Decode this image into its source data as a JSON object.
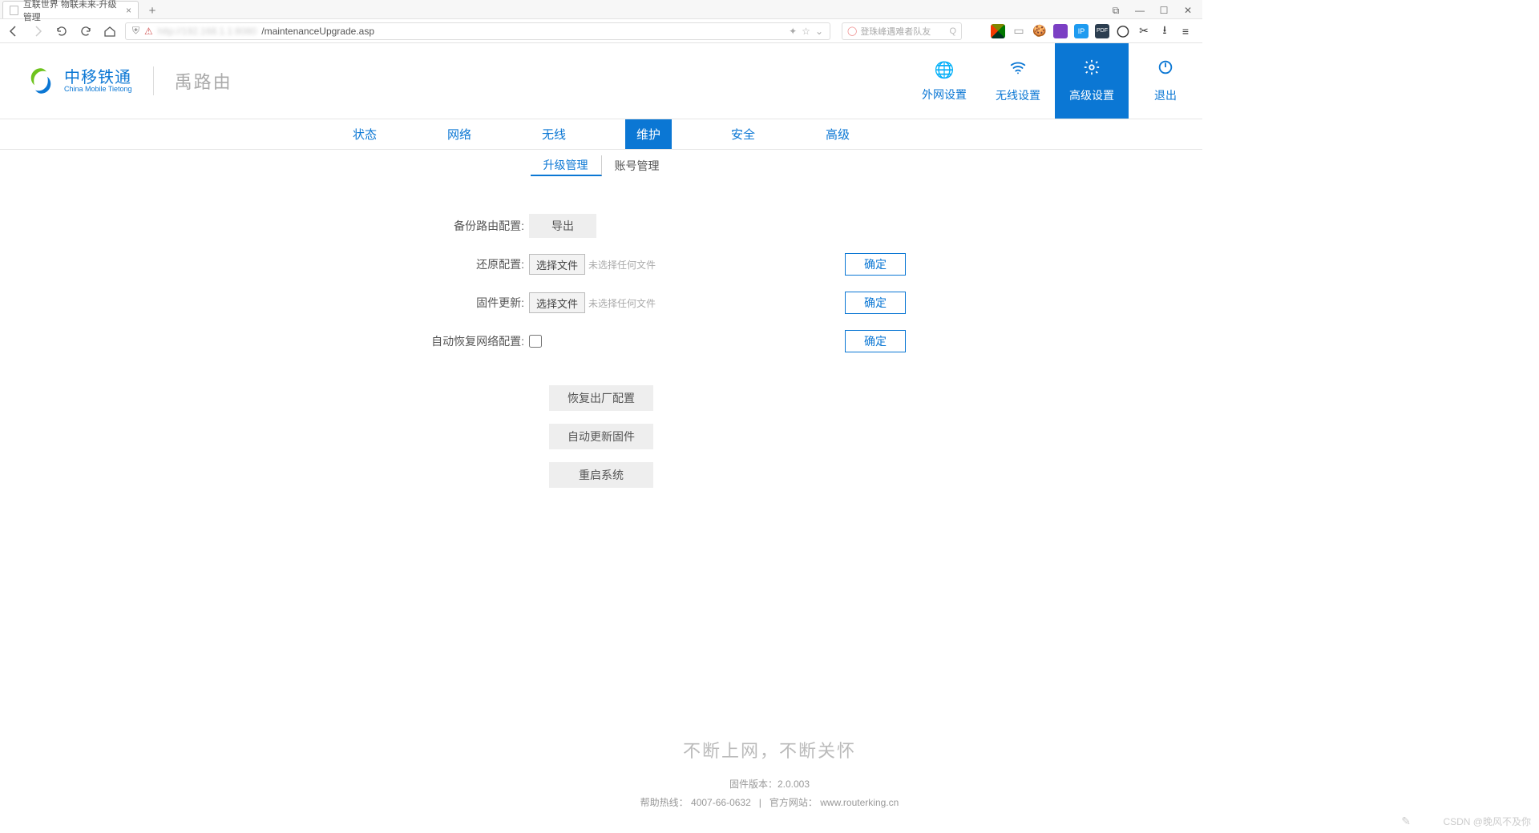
{
  "browser": {
    "tab_title": "互联世界 物联未来-升级管理",
    "url_suffix": "/maintenanceUpgrade.asp",
    "search_placeholder": "登珠峰遇难者队友"
  },
  "header": {
    "brand_cn": "中移铁通",
    "brand_en": "China Mobile Tietong",
    "sub_brand": "禹路由",
    "nav": {
      "wan": "外网设置",
      "wireless": "无线设置",
      "advanced": "高级设置",
      "logout": "退出"
    }
  },
  "subnav": {
    "status": "状态",
    "network": "网络",
    "wireless": "无线",
    "maintenance": "维护",
    "security": "安全",
    "advanced": "高级"
  },
  "subsub": {
    "upgrade": "升级管理",
    "account": "账号管理"
  },
  "form": {
    "backup_label": "备份路由配置:",
    "export_btn": "导出",
    "restore_label": "还原配置:",
    "firmware_label": "固件更新:",
    "choose_file": "选择文件",
    "no_file": "未选择任何文件",
    "confirm": "确定",
    "auto_restore_label": "自动恢复网络配置:",
    "factory_reset": "恢复出厂配置",
    "auto_update_fw": "自动更新固件",
    "reboot": "重启系统"
  },
  "footer": {
    "slogan": "不断上网，不断关怀",
    "fw_version": "固件版本：2.0.003",
    "help_label": "帮助热线：",
    "help_phone": "4007-66-0632",
    "site_label": "官方网站：",
    "site_url": "www.routerking.cn"
  },
  "watermark": "CSDN @晚风不及你"
}
